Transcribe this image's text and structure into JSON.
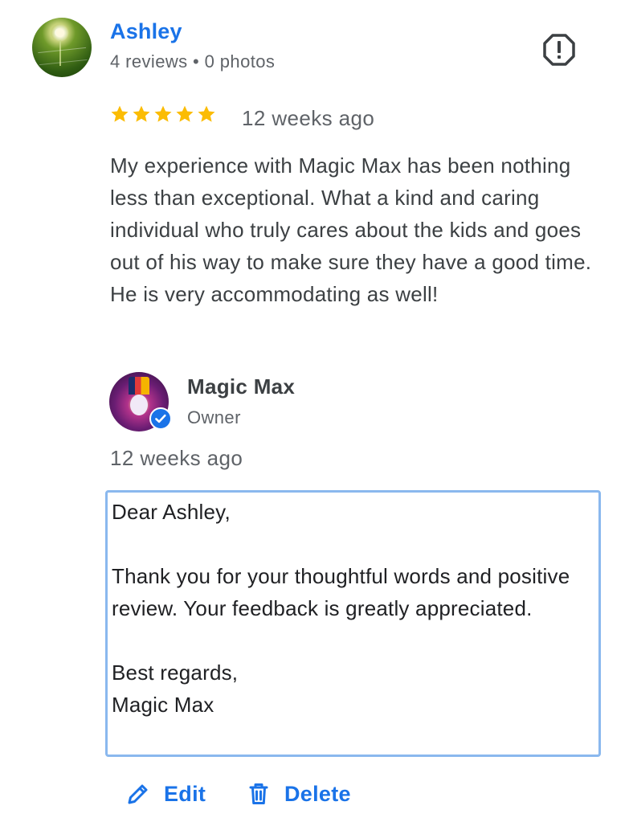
{
  "reviewer": {
    "name": "Ashley",
    "meta": "4 reviews • 0 photos",
    "avatar": "profile-photo"
  },
  "review": {
    "rating": 5,
    "rating_max": 5,
    "time": "12 weeks ago",
    "text": "My experience with Magic Max has been nothing less than exceptional. What a kind and caring individual who truly cares about the kids and goes out of his way to make sure they have a good time. He is very accommodating as well!"
  },
  "owner_response": {
    "name": "Magic Max",
    "role": "Owner",
    "time": "12 weeks ago",
    "reply_text": "Dear Ashley,\n\nThank you for your thoughtful words and positive review. Your feedback is greatly appreciated.\n\nBest regards,\nMagic Max"
  },
  "actions": {
    "edit_label": "Edit",
    "delete_label": "Delete"
  },
  "icons": {
    "report": "report-icon",
    "star": "star-icon",
    "verified": "verified-badge-icon",
    "edit": "pencil-icon",
    "delete": "trash-icon"
  },
  "colors": {
    "accent": "#1a73e8",
    "star": "#fbbc04",
    "secondary_text": "#5f6368",
    "focus_border": "#8ab8ee"
  }
}
